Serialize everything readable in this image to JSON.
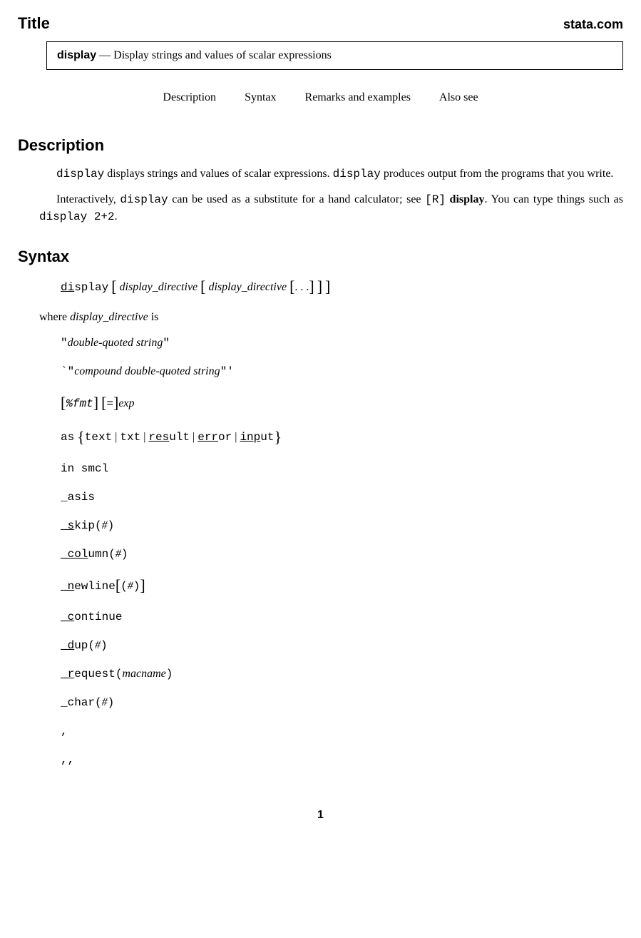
{
  "header": {
    "title": "Title",
    "site": "stata.com"
  },
  "command_box": {
    "name": "display",
    "sep": "—",
    "desc": "Display strings and values of scalar expressions"
  },
  "nav": {
    "description": "Description",
    "syntax": "Syntax",
    "remarks": "Remarks and examples",
    "alsosee": "Also see"
  },
  "sections": {
    "description_heading": "Description",
    "syntax_heading": "Syntax"
  },
  "description": {
    "p1_a": "display",
    "p1_b": " displays strings and values of scalar expressions. ",
    "p1_c": "display",
    "p1_d": " produces output from the programs that you write.",
    "p2_a": "Interactively, ",
    "p2_b": "display",
    "p2_c": " can be used as a substitute for a hand calculator; see ",
    "p2_ref_open": "[R]",
    "p2_ref_cmd": " display",
    "p2_d": ". You can type things such as ",
    "p2_e": "display 2+2",
    "p2_f": "."
  },
  "syntax": {
    "cmd_ul": "di",
    "cmd_rest": "splay",
    "dd1": "display_directive",
    "dd2": "display_directive",
    "dots": ". . .",
    "where_a": "where ",
    "where_b": "display_directive",
    "where_c": " is"
  },
  "directives": {
    "d1_a": "\"",
    "d1_b": "double-quoted string",
    "d1_c": "\"",
    "d2_a": "`\"",
    "d2_b": "compound double-quoted string",
    "d2_c": "\"'",
    "d3_fmt": "%fmt",
    "d3_eq": "=",
    "d3_exp": "exp",
    "d4_as": "as",
    "d4_text": "text",
    "d4_txt": "txt",
    "d4_res_ul": "res",
    "d4_res_rest": "ult",
    "d4_err_ul": "err",
    "d4_err_rest": "or",
    "d4_inp_ul": "inp",
    "d4_inp_rest": "ut",
    "d5": "in smcl",
    "d6": "_asis",
    "d7_ul": "_s",
    "d7_rest": "kip(",
    "d7_hash": "#",
    "d7_close": ")",
    "d8_ul": "_col",
    "d8_rest": "umn(",
    "d8_hash": "#",
    "d8_close": ")",
    "d9_ul": "_n",
    "d9_rest": "ewline",
    "d9_paren_open": "(",
    "d9_hash": "#",
    "d9_paren_close": ")",
    "d10_ul": "_c",
    "d10_rest": "ontinue",
    "d11_ul": "_d",
    "d11_rest": "up(",
    "d11_hash": "#",
    "d11_close": ")",
    "d12_ul": "_r",
    "d12_rest": "equest(",
    "d12_mac": "macname",
    "d12_close": ")",
    "d13_a": "_char(",
    "d13_hash": "#",
    "d13_close": ")",
    "d14": ",",
    "d15": ",,"
  },
  "page_number": "1"
}
